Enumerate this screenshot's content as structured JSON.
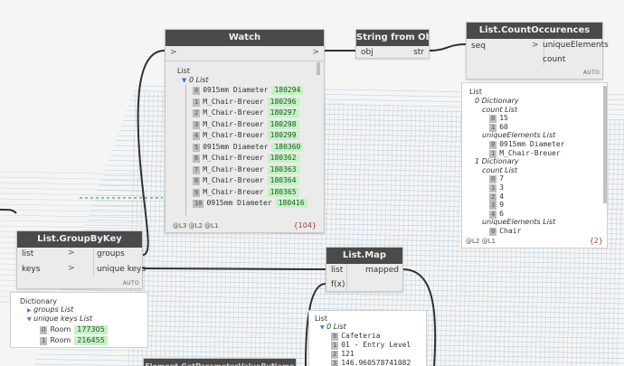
{
  "canvas": {
    "background": "#f5f5f5",
    "grid_color": "#7fa8c8",
    "wire_color": "#303030",
    "dash_color": "#2e8b2e"
  },
  "watch": {
    "title": "Watch",
    "in_arrow": ">",
    "out_arrow": ">",
    "root": "List",
    "level0": "0 List",
    "items": [
      {
        "i": "0",
        "name": "0915mm Diameter",
        "val": "180294"
      },
      {
        "i": "1",
        "name": "M_Chair-Breuer",
        "val": "180296"
      },
      {
        "i": "2",
        "name": "M_Chair-Breuer",
        "val": "180297"
      },
      {
        "i": "3",
        "name": "M_Chair-Breuer",
        "val": "180298"
      },
      {
        "i": "4",
        "name": "M_Chair-Breuer",
        "val": "180299"
      },
      {
        "i": "5",
        "name": "0915mm Diameter",
        "val": "180360"
      },
      {
        "i": "6",
        "name": "M_Chair-Breuer",
        "val": "180362"
      },
      {
        "i": "7",
        "name": "M_Chair-Breuer",
        "val": "180363"
      },
      {
        "i": "8",
        "name": "M_Chair-Breuer",
        "val": "180364"
      },
      {
        "i": "9",
        "name": "M_Chair-Breuer",
        "val": "180365"
      },
      {
        "i": "10",
        "name": "0915mm Diameter",
        "val": "180416"
      }
    ],
    "levels": "@L3 @L2 @L1",
    "count": "{104}"
  },
  "string_node": {
    "title": "String from Object",
    "input": "obj",
    "output": "str"
  },
  "count_node": {
    "title": "List.CountOccurences",
    "input": "seq",
    "input_arrow": ">",
    "outputs": [
      "uniqueElements",
      "count"
    ],
    "lacing": "AUTO",
    "preview": {
      "root": "List",
      "rows": [
        {
          "t": "0 Dictionary",
          "indent": 1,
          "style": "key"
        },
        {
          "t": "count List",
          "indent": 2,
          "style": "key"
        },
        {
          "t": "15",
          "indent": 3,
          "idx": "0"
        },
        {
          "t": "60",
          "indent": 3,
          "idx": "1"
        },
        {
          "t": "uniqueElements List",
          "indent": 2,
          "style": "key"
        },
        {
          "t": "0915mm Diameter",
          "indent": 3,
          "idx": "0"
        },
        {
          "t": "M_Chair-Breuer",
          "indent": 3,
          "idx": "1"
        },
        {
          "t": "1 Dictionary",
          "indent": 1,
          "style": "key"
        },
        {
          "t": "count List",
          "indent": 2,
          "style": "key"
        },
        {
          "t": "7",
          "indent": 3,
          "idx": "0"
        },
        {
          "t": "3",
          "indent": 3,
          "idx": "1"
        },
        {
          "t": "4",
          "indent": 3,
          "idx": "2"
        },
        {
          "t": "9",
          "indent": 3,
          "idx": "3"
        },
        {
          "t": "6",
          "indent": 3,
          "idx": "4"
        },
        {
          "t": "uniqueElements List",
          "indent": 2,
          "style": "key"
        },
        {
          "t": "Chair",
          "indent": 3,
          "idx": "0"
        }
      ],
      "levels": "@L2 @L1",
      "count": "{2}"
    }
  },
  "groupbykey": {
    "title": "List.GroupByKey",
    "inputs": [
      "list",
      "keys"
    ],
    "input_arrow": ">",
    "outputs": [
      "groups",
      "unique keys"
    ],
    "lacing": "AUTO",
    "preview": {
      "root": "Dictionary",
      "groups": "groups List",
      "unique": "unique keys List",
      "items": [
        {
          "i": "0",
          "name": "Room",
          "val": "177305"
        },
        {
          "i": "1",
          "name": "Room",
          "val": "216455"
        }
      ]
    }
  },
  "listmap": {
    "title": "List.Map",
    "inputs": [
      "list",
      "f(x)"
    ],
    "output": "mapped",
    "preview": {
      "root": "List",
      "level0": "0 List",
      "items": [
        {
          "i": "0",
          "t": "Cafeteria"
        },
        {
          "i": "1",
          "t": "01 - Entry Level"
        },
        {
          "i": "2",
          "t": "121"
        },
        {
          "i": "3",
          "t": "146.960578741082"
        }
      ]
    }
  },
  "partial_node": {
    "title": "Element.GetParameterValueByName"
  }
}
